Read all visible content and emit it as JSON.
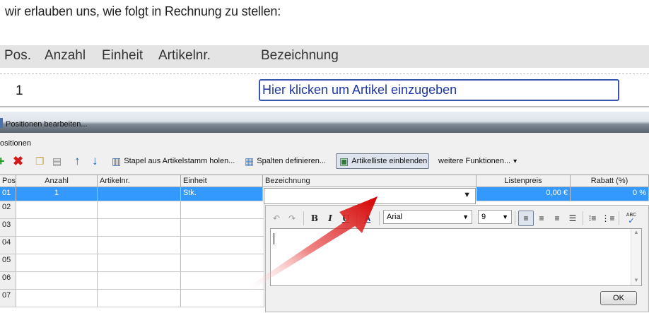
{
  "document": {
    "intro_text": "wir erlauben uns, wie folgt in Rechnung zu stellen:",
    "columns": [
      "Pos.",
      "Anzahl",
      "Einheit",
      "Artikelnr.",
      "Bezeichnung"
    ],
    "first_position": "1",
    "article_prompt": "Hier klicken um Artikel einzugeben"
  },
  "window": {
    "title": "Positionen bearbeiten...",
    "group_label": "ositionen",
    "toolbar": {
      "add_icon": "add-icon",
      "delete_icon": "delete-icon",
      "copy_icon": "copy-icon",
      "paste_icon": "paste-icon",
      "move_up_icon": "arrow-up-icon",
      "move_down_icon": "arrow-down-icon",
      "stack_label": "Stapel aus Artikelstamm holen...",
      "columns_label": "Spalten definieren...",
      "article_list_label": "Artikelliste einblenden",
      "more_label": "weitere Funktionen...",
      "more_arrow": "▾"
    },
    "grid": {
      "headers": {
        "pos": "Pos.",
        "anzahl": "Anzahl",
        "artikelnr": "Artikelnr.",
        "einheit": "Einheit",
        "bezeichnung": "Bezeichnung",
        "listenpreis": "Listenpreis",
        "rabatt": "Rabatt (%)"
      },
      "rows": [
        {
          "pos": "01",
          "anzahl": "1",
          "artikelnr": "",
          "einheit": "Stk.",
          "listenpreis": "0,00 €",
          "rabatt": "0 %"
        },
        {
          "pos": "02"
        },
        {
          "pos": "03"
        },
        {
          "pos": "04"
        },
        {
          "pos": "05"
        },
        {
          "pos": "06"
        },
        {
          "pos": "07"
        }
      ],
      "selection_color": "#3399ff"
    },
    "editor": {
      "font": "Arial",
      "size": "9",
      "ok_label": "OK",
      "bold": "B",
      "italic": "I",
      "underline": "U",
      "text_color": "A",
      "spell_label": "ABC"
    }
  }
}
